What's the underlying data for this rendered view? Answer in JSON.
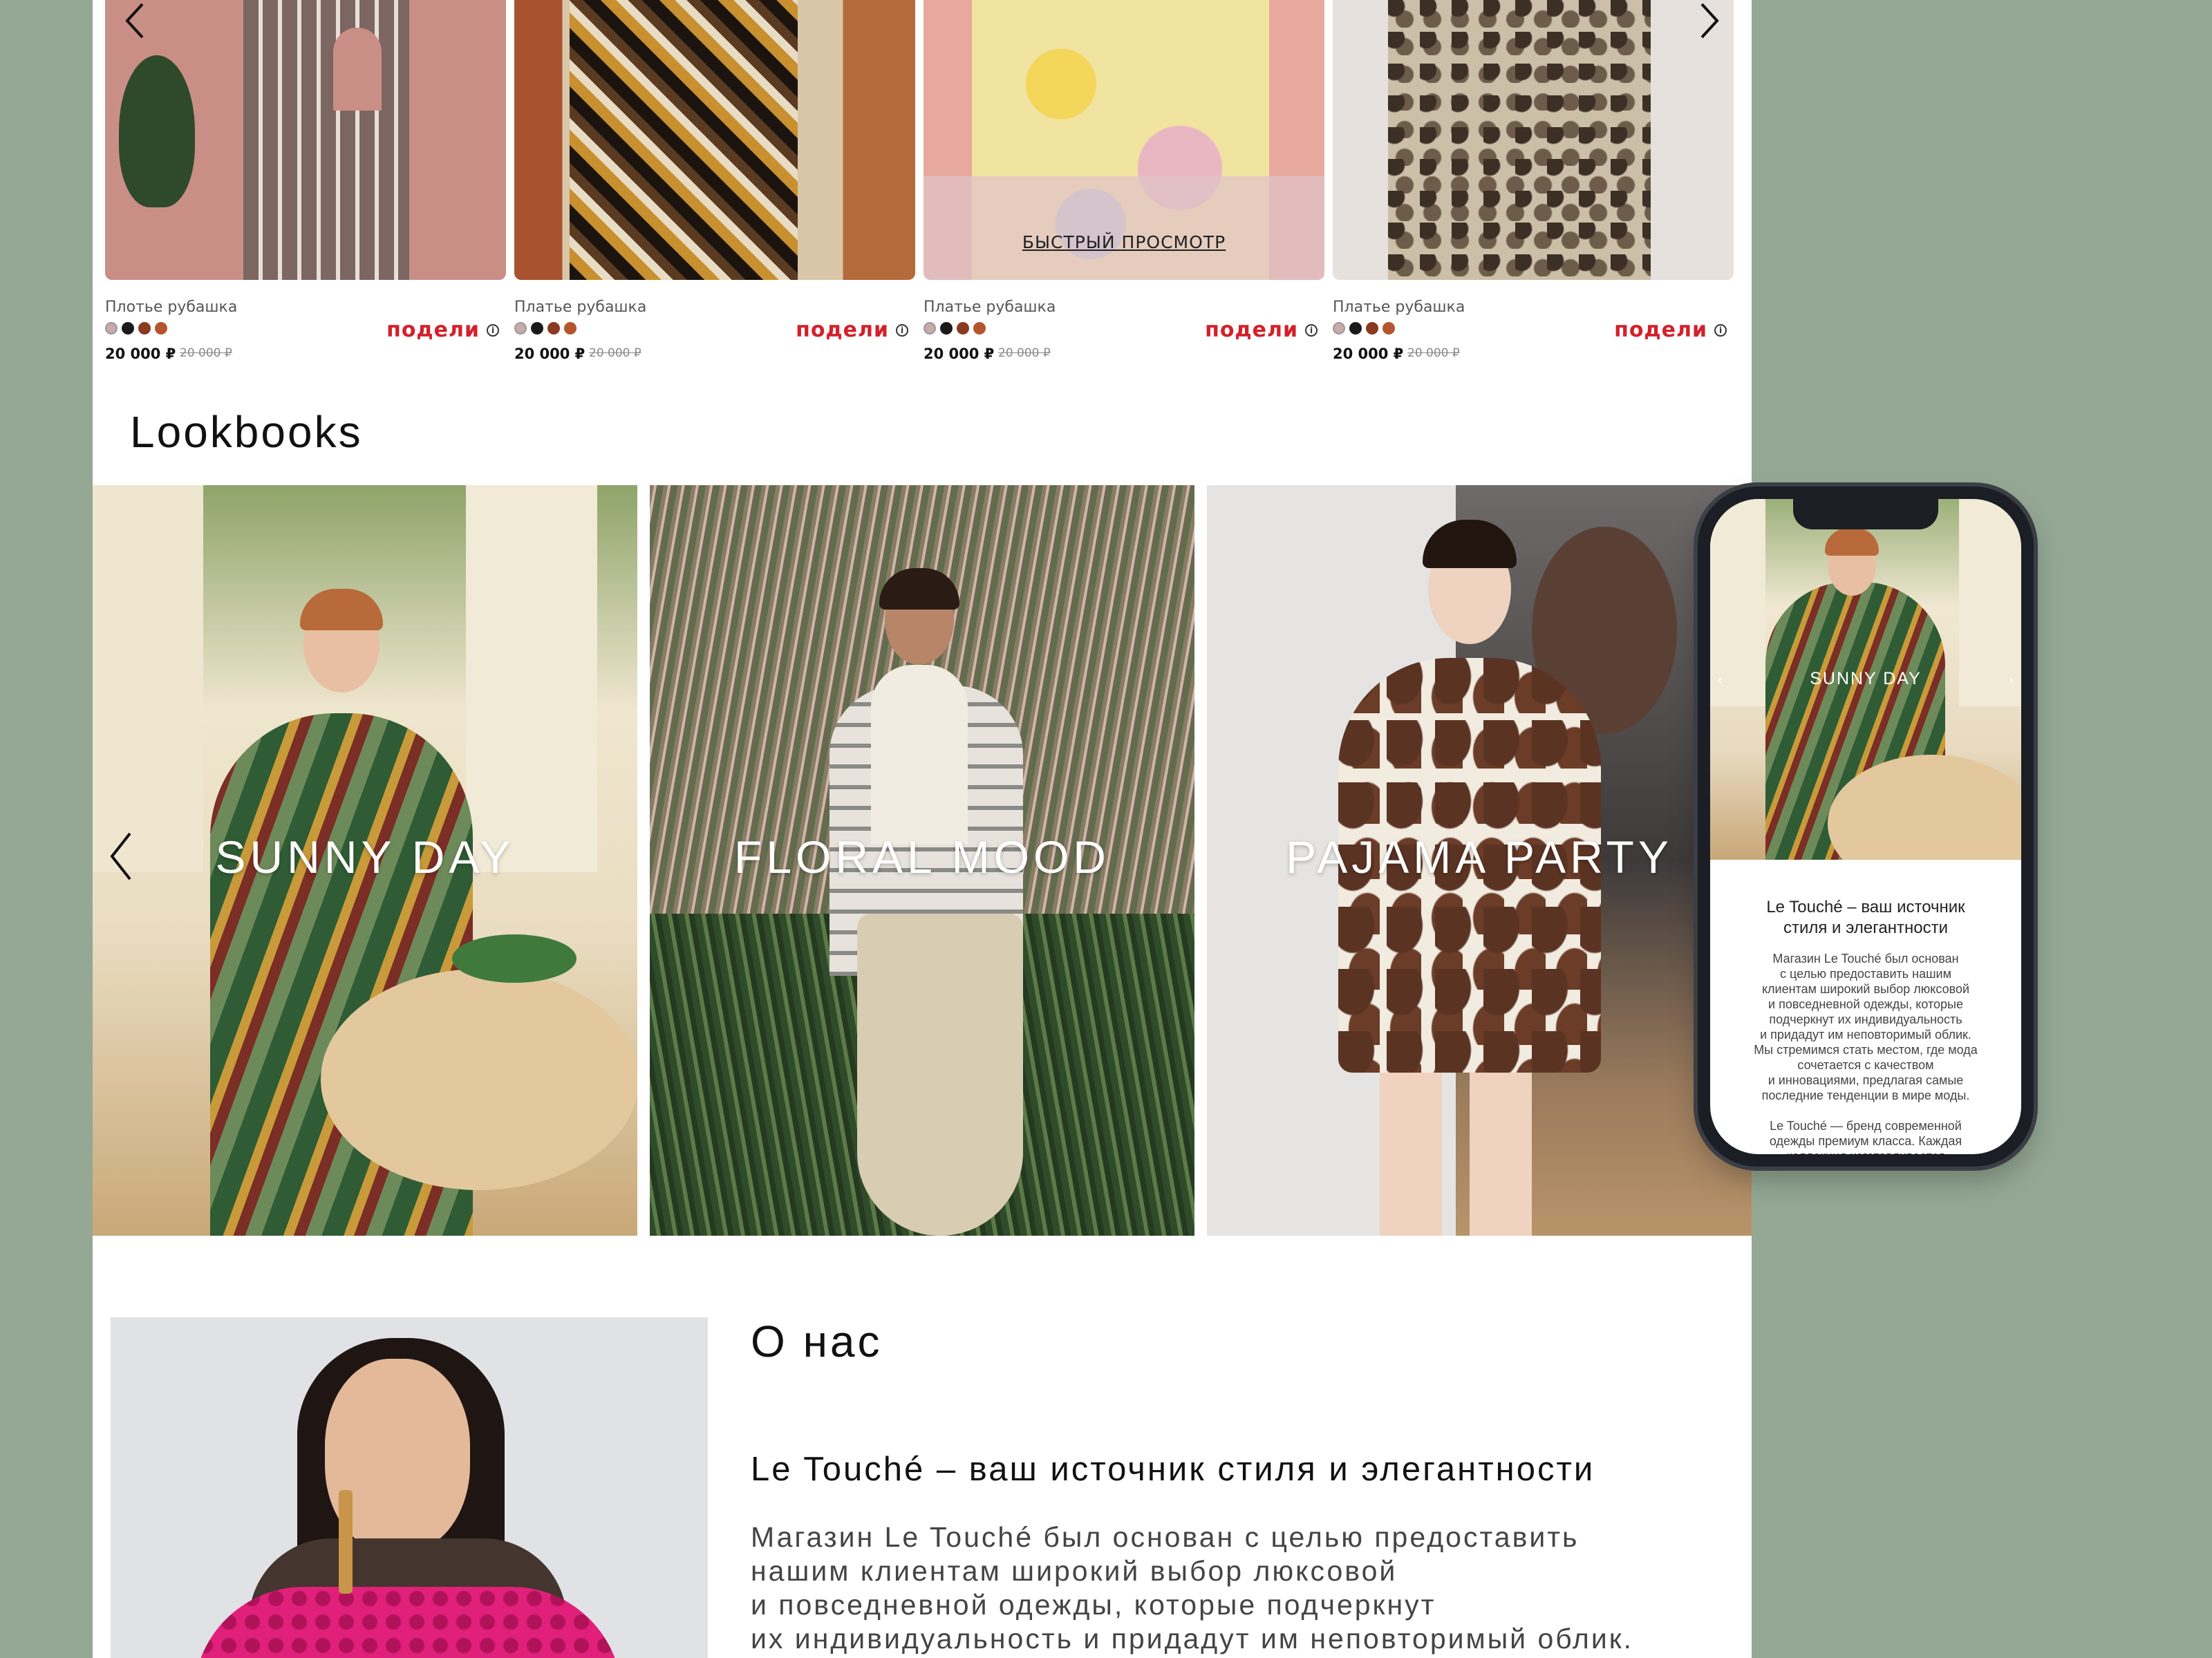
{
  "colors": {
    "background": "#94a894",
    "accent": "#d4202a",
    "page": "#ffffff"
  },
  "products": {
    "quick_view": "БЫСТРЫЙ ПРОСМОТР",
    "items": [
      {
        "name": "Плотье рубашка",
        "price": "20 000 ₽",
        "old_price": "20 000 ₽",
        "split_label": "подели",
        "info_icon": "i",
        "swatches": [
          "#c9a9a9",
          "#1a1a1a",
          "#8a3a20",
          "#b5552d"
        ]
      },
      {
        "name": "Платье рубашка",
        "price": "20 000 ₽",
        "old_price": "20 000 ₽",
        "split_label": "подели",
        "info_icon": "i",
        "swatches": [
          "#c9a9a9",
          "#1a1a1a",
          "#8a3a20",
          "#b5552d"
        ]
      },
      {
        "name": "Платье рубашка",
        "price": "20 000 ₽",
        "old_price": "20 000 ₽",
        "split_label": "подели",
        "info_icon": "i",
        "swatches": [
          "#c9a9a9",
          "#1a1a1a",
          "#8a3a20",
          "#b5552d"
        ]
      },
      {
        "name": "Платье рубашка",
        "price": "20 000 ₽",
        "old_price": "20 000 ₽",
        "split_label": "подели",
        "info_icon": "i",
        "swatches": [
          "#c9a9a9",
          "#1a1a1a",
          "#8a3a20",
          "#b5552d"
        ]
      }
    ]
  },
  "lookbooks": {
    "title": "Lookbooks",
    "items": [
      {
        "label": "SUNNY DAY"
      },
      {
        "label": "FLORAL MOOD"
      },
      {
        "label": "PAJAMA PARTY"
      }
    ]
  },
  "about": {
    "title": "О нас",
    "subtitle": "Le Touché – ваш источник стиля и элегантности",
    "text": "Магазин Le Touché был основан с целью предоставить\nнашим клиентам широкий выбор люксовой\nи повседневной одежды, которые подчеркнут\nих индивидуальность и придадут им неповторимый облик."
  },
  "mobile": {
    "hero_label": "SUNNY DAY",
    "title": "Le Touché – ваш источник\nстиля и элегантности",
    "text": "Магазин Le Touché был основан\nс целью предоставить нашим\nклиентам широкий выбор люксовой\nи повседневной одежды, которые\nподчеркнут их индивидуальность\nи придадут им неповторимый облик.\nМы стремимся стать местом, где мода\nсочетается с качеством\nи инновациями, предлагая самые\nпоследние тенденции в мире моды.\n\nLe Touché — бренд современной\nодежды премиум класса. Каждая\nколлекция изготавливается"
  },
  "icons": {
    "prev": "chevron-left-icon",
    "next": "chevron-right-icon",
    "info": "info-icon"
  }
}
